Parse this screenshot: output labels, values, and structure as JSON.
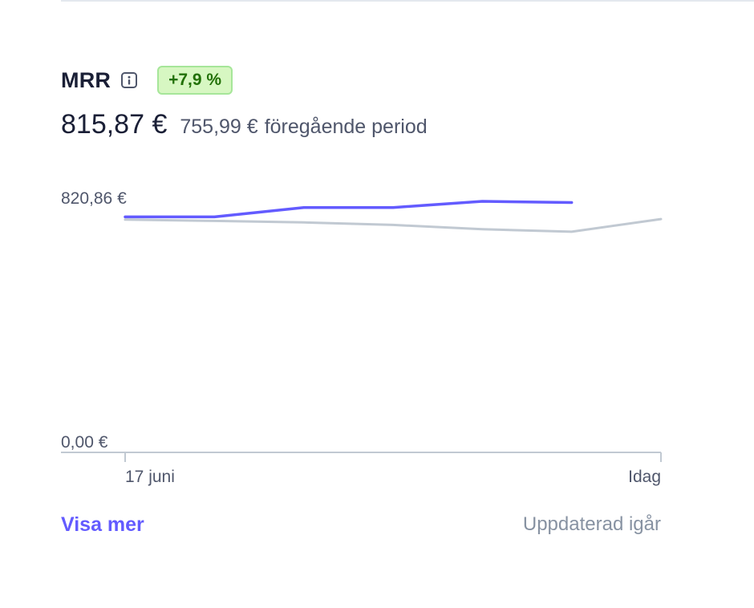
{
  "metric": {
    "title": "MRR",
    "info_icon": "info-icon",
    "change_badge": "+7,9 %",
    "current_value": "815,87 €",
    "previous_value": "755,99 €",
    "previous_label": "föregående period"
  },
  "colors": {
    "accent": "#635bff",
    "badge_bg": "#d7f7c2",
    "badge_border": "#a6e699",
    "badge_text": "#217005",
    "comparison_line": "#c1c9d2",
    "muted_text": "#8792a2"
  },
  "chart_data": {
    "type": "line",
    "y_max_label": "820,86 €",
    "y_min_label": "0,00 €",
    "x_start_label": "17 juni",
    "x_end_label": "Idag",
    "ylim": [
      0,
      820.86
    ],
    "grid": false,
    "x_count": 7,
    "series": [
      {
        "color": "#635bff",
        "values": [
          758.0,
          758.0,
          788.0,
          788.0,
          808.0,
          804.0
        ]
      },
      {
        "color": "#c1c9d2",
        "values": [
          749.0,
          745.0,
          740.0,
          732.0,
          718.0,
          710.0,
          751.0
        ]
      }
    ]
  },
  "footer": {
    "show_more": "Visa mer",
    "updated": "Uppdaterad igår"
  }
}
